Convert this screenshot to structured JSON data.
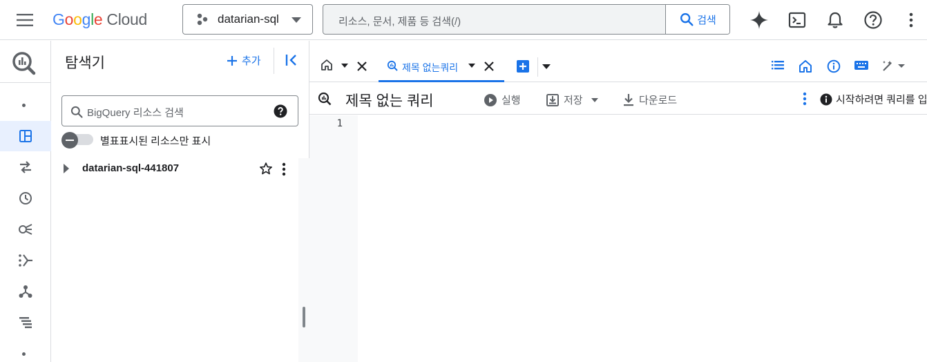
{
  "header": {
    "logo": {
      "google_letters": [
        {
          "ch": "G",
          "color": "#4285F4"
        },
        {
          "ch": "o",
          "color": "#EA4335"
        },
        {
          "ch": "o",
          "color": "#FBBC05"
        },
        {
          "ch": "g",
          "color": "#4285F4"
        },
        {
          "ch": "l",
          "color": "#34A853"
        },
        {
          "ch": "e",
          "color": "#EA4335"
        }
      ],
      "cloud": "Cloud"
    },
    "project_name": "datarian-sql",
    "search_placeholder": "리소스, 문서, 제품 등 검색(/)",
    "search_button": "검색",
    "icons": [
      "gemini-sparkle-icon",
      "cloud-shell-icon",
      "notifications-bell-icon",
      "help-icon",
      "more-vert-icon"
    ]
  },
  "explorer": {
    "title": "탐색기",
    "add_label": "추가",
    "search_placeholder": "BigQuery 리소스 검색",
    "starred_only_label": "별표표시된 리소스만 표시",
    "projects": [
      {
        "name": "datarian-sql-441807"
      }
    ]
  },
  "tabs": {
    "active_tab_label": "제목 없는쿼리"
  },
  "query": {
    "title": "제목 없는 쿼리",
    "run_label": "실행",
    "save_label": "저장",
    "download_label": "다운로드",
    "hint": "시작하려면 쿼리를 입"
  },
  "editor": {
    "line_numbers": [
      "1"
    ]
  },
  "colors": {
    "accent": "#1a73e8",
    "icon_gray": "#5f6368",
    "border": "#dadce0",
    "active_bg": "#e8f0fe"
  }
}
